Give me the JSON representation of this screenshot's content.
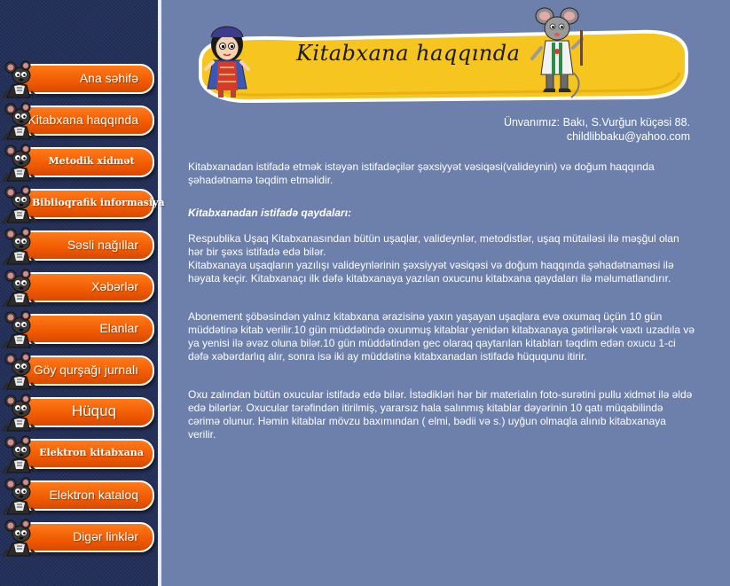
{
  "sidebar": {
    "items": [
      {
        "label": "Ana səhifə",
        "style": "sans"
      },
      {
        "label": "Kitabxana haqqında",
        "style": "sans"
      },
      {
        "label": "Metodik xidmət",
        "style": "serif"
      },
      {
        "label": "Biblioqrafik informasiya",
        "style": "serif"
      },
      {
        "label": "Səsli nağıllar",
        "style": "sans"
      },
      {
        "label": "Xəbərlər",
        "style": "sans"
      },
      {
        "label": "Elanlar",
        "style": "sans"
      },
      {
        "label": "Göy qurşağı jurnalı",
        "style": "sans"
      },
      {
        "label": "Hüquq",
        "style": "big"
      },
      {
        "label": "Elektron kitabxana",
        "style": "serif"
      },
      {
        "label": "Elektron kataloq",
        "style": "sans"
      },
      {
        "label": "Digər linklər",
        "style": "sans"
      }
    ]
  },
  "header": {
    "title": "Kitabxana haqqında"
  },
  "address": {
    "line1": "Ünvanımız: Bakı, S.Vurğun küçəsi 88.",
    "email": "childlibbaku@yahoo.com"
  },
  "content": {
    "intro": "Kitabxanadan istifadə etmək istəyən istifadəçilər şəxsiyyət vəsiqəsi(valideynin) və doğum haqqında şəhadətnamə təqdim etməlidir.",
    "rules_title": "Kitabxanadan istifadə qaydaları:",
    "para1": "Respublika Uşaq Kitabxanasından bütün uşaqlar, valideynlər, metodistlər, uşaq mütailəsi ilə məşğul olan hər bir şəxs istifadə edə bilər.",
    "para2": "Kitabxanaya uşaqların yazılışı valideynlərinin şəxsiyyət vəsiqəsi və doğum haqqında şəhadətnaməsi ilə həyata keçir. Kitabxanaçı ilk dəfə kitabxanaya yazılan oxucunu kitabxana qaydaları ilə məlumatlandırır.",
    "para3": "Abonement şöbəsindən yalnız kitabxana ərazisinə yaxın yaşayan uşaqlara evə oxumaq üçün 10 gün müddətinə kitab verilir.10 gün müddətində oxunmuş kitablar yenidən kitabxanaya gətirilərək vaxtı uzadıla və ya yenisi ilə əvəz oluna bilər.10 gün müddətindən gec olaraq qaytarılan kitabları təqdim edən oxucu 1-ci dəfə xəbərdarlıq alır, sonra isə iki ay müddətinə kitabxanadan istifadə hüququnu itirir.",
    "para4": "Oxu zalından bütün oxucular istifadə edə bilər. İstədikləri hər bir materialın foto-surətini pullu xidmət ilə əldə edə bilərlər. Oxucular tərəfindən itirilmiş, yararsız hala salınmış kitablar dəyərinin 10 qatı müqabilində cərimə olunur. Həmin kitablar mövzu baxımından ( elmi, bədii və s.) uyğun olmaqla alınıb kitabxanaya verilir."
  },
  "colors": {
    "background": "#6d7fab",
    "sidebar": "#23305a",
    "nav_button": "#f05a00",
    "banner": "#f7c520"
  },
  "icons": {
    "nav_mascot": "mouse-mascot-icon",
    "header_left": "girl-illustration",
    "header_right": "mouse-doctor-illustration"
  }
}
